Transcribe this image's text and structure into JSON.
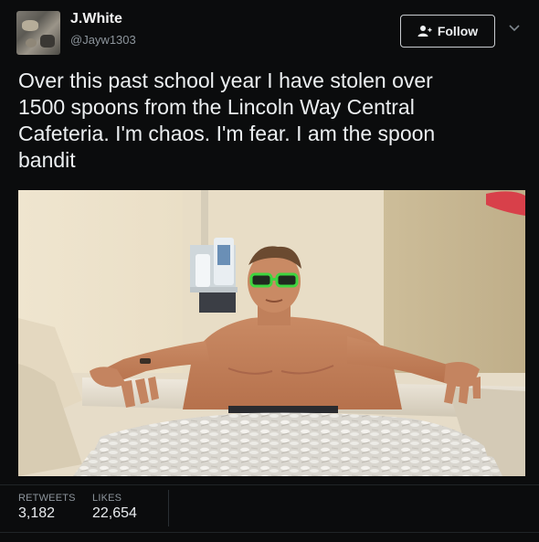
{
  "tweet": {
    "author_name": "J.White",
    "author_handle": "@Jayw1303",
    "follow_label": "Follow",
    "text": "Over this past school year I have stolen over\n1500 spoons from the Lincoln Way Central\nCafeteria. I'm chaos. I'm fear. I am the spoon\nbandit"
  },
  "stats": {
    "retweets_label": "RETWEETS",
    "retweets_value": "3,182",
    "likes_label": "LIKES",
    "likes_value": "22,654"
  },
  "icons": {
    "follow": "add-user-icon",
    "menu": "chevron-down-icon"
  },
  "colors": {
    "background": "#0b0c0d",
    "text": "#e9ecef",
    "muted": "#8d959c"
  }
}
